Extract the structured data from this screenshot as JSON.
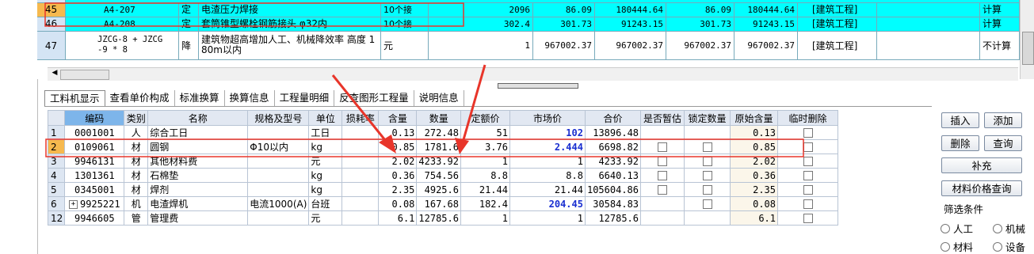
{
  "top_grid": {
    "rows": [
      {
        "idx": "45",
        "code": "A4-207",
        "type": "定",
        "name": "电渣压力焊接",
        "unit": "10个接",
        "qty": "2096",
        "price": "86.09",
        "total": "180444.64",
        "price2": "86.09",
        "total2": "180444.64",
        "category": "[建筑工程]",
        "calc": "计算"
      },
      {
        "idx": "46",
        "code": "A4-208",
        "type": "定",
        "name": "套筒锥型螺栓钢筋接头 φ32内",
        "unit": "10个接",
        "qty": "302.4",
        "price": "301.73",
        "total": "91243.15",
        "price2": "301.73",
        "total2": "91243.15",
        "category": "[建筑工程]",
        "calc": "计算"
      },
      {
        "idx": "47",
        "code_line1": "JZCG-8 + JZCG",
        "code_line2": "-9 * 8",
        "type": "降",
        "name_line1": "建筑物超高增加人工、机械降效率 高度 1",
        "name_line2": "80m以内",
        "unit": "元",
        "qty": "1",
        "price": "967002.37",
        "total": "967002.37",
        "price2": "967002.37",
        "total2": "967002.37",
        "category": "[建筑工程]",
        "calc": "不计算"
      }
    ]
  },
  "tabs": [
    "工料机显示",
    "查看单价构成",
    "标准换算",
    "换算信息",
    "工程量明细",
    "反查图形工程量",
    "说明信息"
  ],
  "columns": [
    "编码",
    "类别",
    "名称",
    "规格及型号",
    "单位",
    "损耗率",
    "含量",
    "数量",
    "定额价",
    "市场价",
    "合价",
    "是否暂估",
    "锁定数量",
    "原始含量",
    "临时删除"
  ],
  "materials": [
    {
      "rn": "1",
      "code": "0001001",
      "type": "人",
      "name": "综合工日",
      "spec": "",
      "unit": "工日",
      "loss": "",
      "content": "0.13",
      "qty": "272.48",
      "quota": "51",
      "market": "102",
      "total": "13896.48",
      "est": false,
      "lock": false,
      "orig": "0.13"
    },
    {
      "rn": "2",
      "code": "0109061",
      "type": "材",
      "name": "圆钢",
      "spec": "Φ10以内",
      "unit": "kg",
      "loss": "",
      "content": "0.85",
      "qty": "1781.6",
      "quota": "3.76",
      "market": "2.444",
      "total": "6698.82",
      "est": true,
      "lock": true,
      "orig": "0.85"
    },
    {
      "rn": "3",
      "code": "9946131",
      "type": "材",
      "name": "其他材料费",
      "spec": "",
      "unit": "元",
      "loss": "",
      "content": "2.02",
      "qty": "4233.92",
      "quota": "1",
      "market": "1",
      "total": "4233.92",
      "est": true,
      "lock": true,
      "orig": "2.02"
    },
    {
      "rn": "4",
      "code": "1301361",
      "type": "材",
      "name": "石棉垫",
      "spec": "",
      "unit": "kg",
      "loss": "",
      "content": "0.36",
      "qty": "754.56",
      "quota": "8.8",
      "market": "8.8",
      "total": "6640.13",
      "est": true,
      "lock": true,
      "orig": "0.36"
    },
    {
      "rn": "5",
      "code": "0345001",
      "type": "材",
      "name": "焊剂",
      "spec": "",
      "unit": "kg",
      "loss": "",
      "content": "2.35",
      "qty": "4925.6",
      "quota": "21.44",
      "market": "21.44",
      "total": "105604.86",
      "est": true,
      "lock": true,
      "orig": "2.35"
    },
    {
      "rn": "6",
      "code": "9925221",
      "type": "机",
      "name": "电渣焊机",
      "spec": "电流1000(A)",
      "unit": "台班",
      "loss": "",
      "content": "0.08",
      "qty": "167.68",
      "quota": "182.4",
      "market": "204.45",
      "total": "30584.83",
      "est": false,
      "lock": true,
      "orig": "0.08"
    },
    {
      "rn": "12",
      "code": "9946605",
      "type": "管",
      "name": "管理费",
      "spec": "",
      "unit": "元",
      "loss": "",
      "content": "6.1",
      "qty": "12785.6",
      "quota": "1",
      "market": "1",
      "total": "12785.6",
      "est": false,
      "lock": false,
      "orig": "6.1"
    }
  ],
  "buttons": {
    "insert": "插入",
    "add": "添加",
    "delete": "删除",
    "query": "查询",
    "supplement": "补充",
    "price_query": "材料价格查询"
  },
  "filter": {
    "title": "筛选条件",
    "options": [
      "人工",
      "机械",
      "材料",
      "设备"
    ]
  },
  "colors": {
    "top_row_bg": "#00ffff",
    "selected_index": "#f6b94e",
    "header_highlight": "#7db5ea",
    "market_price_text": "#1a2fd0",
    "annotation_red": "#e8352a"
  }
}
